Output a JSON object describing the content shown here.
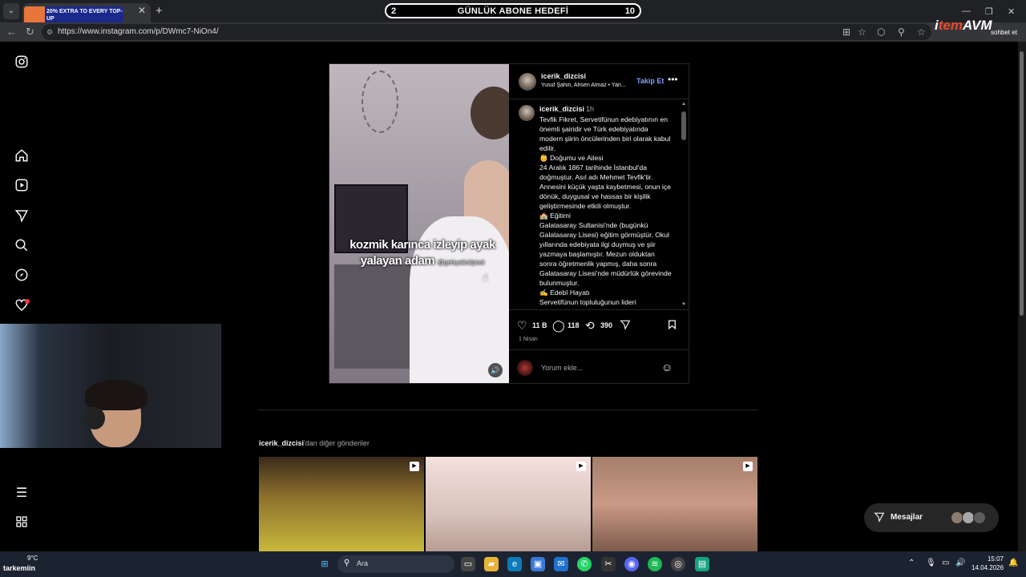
{
  "browser": {
    "tab_ad_text": "20% EXTRA TO EVERY TOP-UP",
    "url": "https://www.instagram.com/p/DWmc7-NiOn4/"
  },
  "overlay_goal": {
    "left": "2",
    "title": "GÜNLÜK ABONE HEDEFİ",
    "right": "10"
  },
  "brand": {
    "logo_a": "i",
    "logo_b": "tem",
    "logo_c": "AVM",
    "sub": "sohbet et"
  },
  "post": {
    "video_caption": "kozmik karınca izleyip ayak yalayan adam",
    "video_tag": "@gelsyaksitpost",
    "username": "icerik_dizcisi",
    "subline": "Yusuf Şahin, Ahsen Almaz • Yan...",
    "follow_label": "Takip Et",
    "caption_user": "icerik_dizcisi",
    "caption_time": "1h",
    "caption_text": "Tevfik Fikret, Servetifünun edebiyatının en önemli şairidir ve Türk edebiyatında modern şiirin öncülerinden biri olarak kabul edilir.\n👶 Doğumu ve Ailesi\n24 Aralık 1867 tarihinde İstanbul'da doğmuştur. Asıl adı Mehmet Tevfik'tir. Annesini küçük yaşta kaybetmesi, onun içe dönük, duygusal ve hassas bir kişilik geliştirmesinde etkili olmuştur.\n🏫 Eğitimi\nGalatasaray Sultanisi'nde (bugünkü Galatasaray Lisesi) eğitim görmüştür. Okul yıllarında edebiyata ilgi duymuş ve şiir yazmaya başlamıştır. Mezun olduktan sonra öğretmenlik yapmış, daha sonra Galatasaray Lisesi'nde müdürlük görevinde bulunmuştur.\n✍️ Edebî Hayatı\nServetifünun topluluğunun lideri",
    "likes": "11 B",
    "comments": "118",
    "reposts": "390",
    "date": "1 Nisan",
    "comment_placeholder": "Yorum ekle..."
  },
  "more_posts": {
    "user": "icerik_dizcisi",
    "suffix": "'dan diğer gönderiler"
  },
  "messages": {
    "label": "Mesajlar"
  },
  "taskbar": {
    "temp": "9°C",
    "weather_label": "tarkemiin",
    "search": "Ara",
    "time": "15:07",
    "date": "14.04.2026"
  },
  "colors": {
    "accent_link": "#85a1ff",
    "notification": "#ff3040",
    "goal_bg": "#000000"
  }
}
